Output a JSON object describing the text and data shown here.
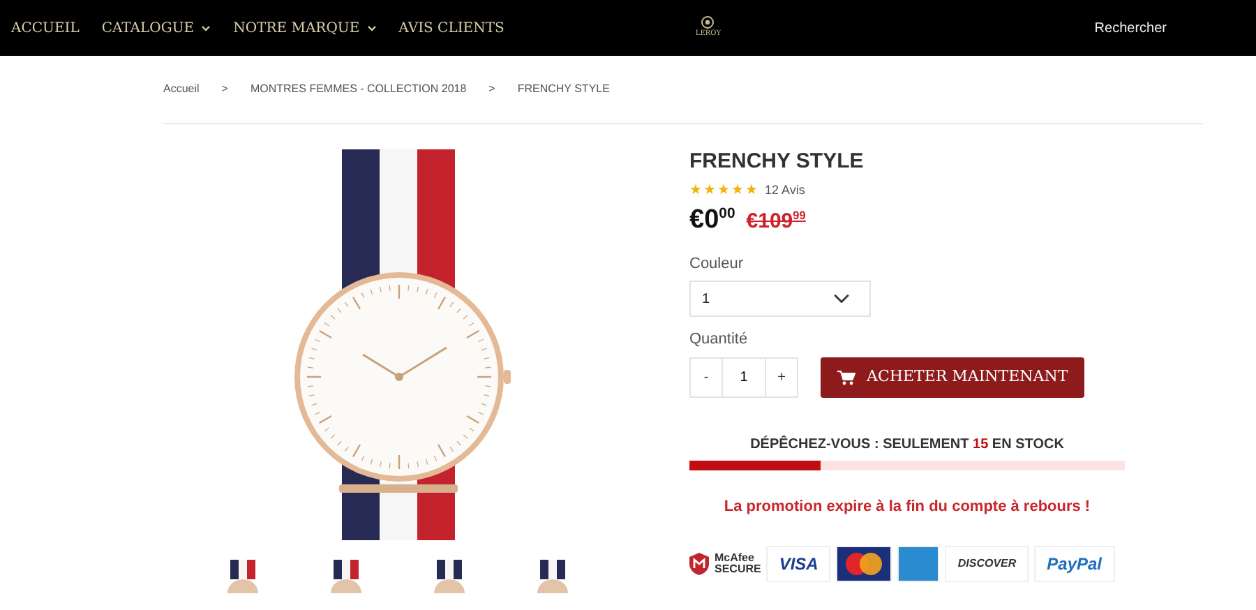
{
  "nav": {
    "items": [
      {
        "label": "ACCUEIL",
        "dropdown": false
      },
      {
        "label": "CATALOGUE",
        "dropdown": true
      },
      {
        "label": "NOTRE MARQUE",
        "dropdown": true
      },
      {
        "label": "AVIS CLIENTS",
        "dropdown": false
      }
    ],
    "logo_text": "LEROY",
    "search": "Rechercher"
  },
  "breadcrumb": [
    {
      "label": "Accueil"
    },
    {
      "label": "MONTRES FEMMES - COLLECTION 2018"
    },
    {
      "label": "FRENCHY STYLE"
    }
  ],
  "breadcrumb_separator": ">",
  "product": {
    "title": "FRENCHY STYLE",
    "stars": 5,
    "reviews": "12 Avis",
    "price": "€0$^{00}$",
    "old_price": "€109$^{99}$",
    "color_label": "Couleur",
    "color_value": "1",
    "quantity_label": "Quantité",
    "minus": "-",
    "quantity": "1",
    "plus": "+",
    "buy_button": "ACHETER MAINTENANT",
    "stock": {
      "before": "DÉPÊCHEZ-VOUS : SEULEMENT ",
      "count": "15",
      "after": " EN STOCK",
      "level": 0.3
    },
    "promo": "La promotion expire à la fin du compte à rebours !",
    "badges": [
      {
        "kind": "secure",
        "line1": "McAfee",
        "line2": "SECURE"
      },
      {
        "kind": "text",
        "text": "VISA",
        "color": "#1a3d8f"
      },
      {
        "kind": "circles"
      },
      {
        "kind": "plain"
      },
      {
        "kind": "text",
        "text": "DISCOVER",
        "color": "#333333"
      },
      {
        "kind": "text",
        "text": "PayPal",
        "color": "#1d6fc1"
      }
    ]
  },
  "thumbnails": [
    {
      "kind": "flag"
    },
    {
      "kind": "flag"
    },
    {
      "kind": "navy"
    },
    {
      "kind": "navy"
    }
  ]
}
